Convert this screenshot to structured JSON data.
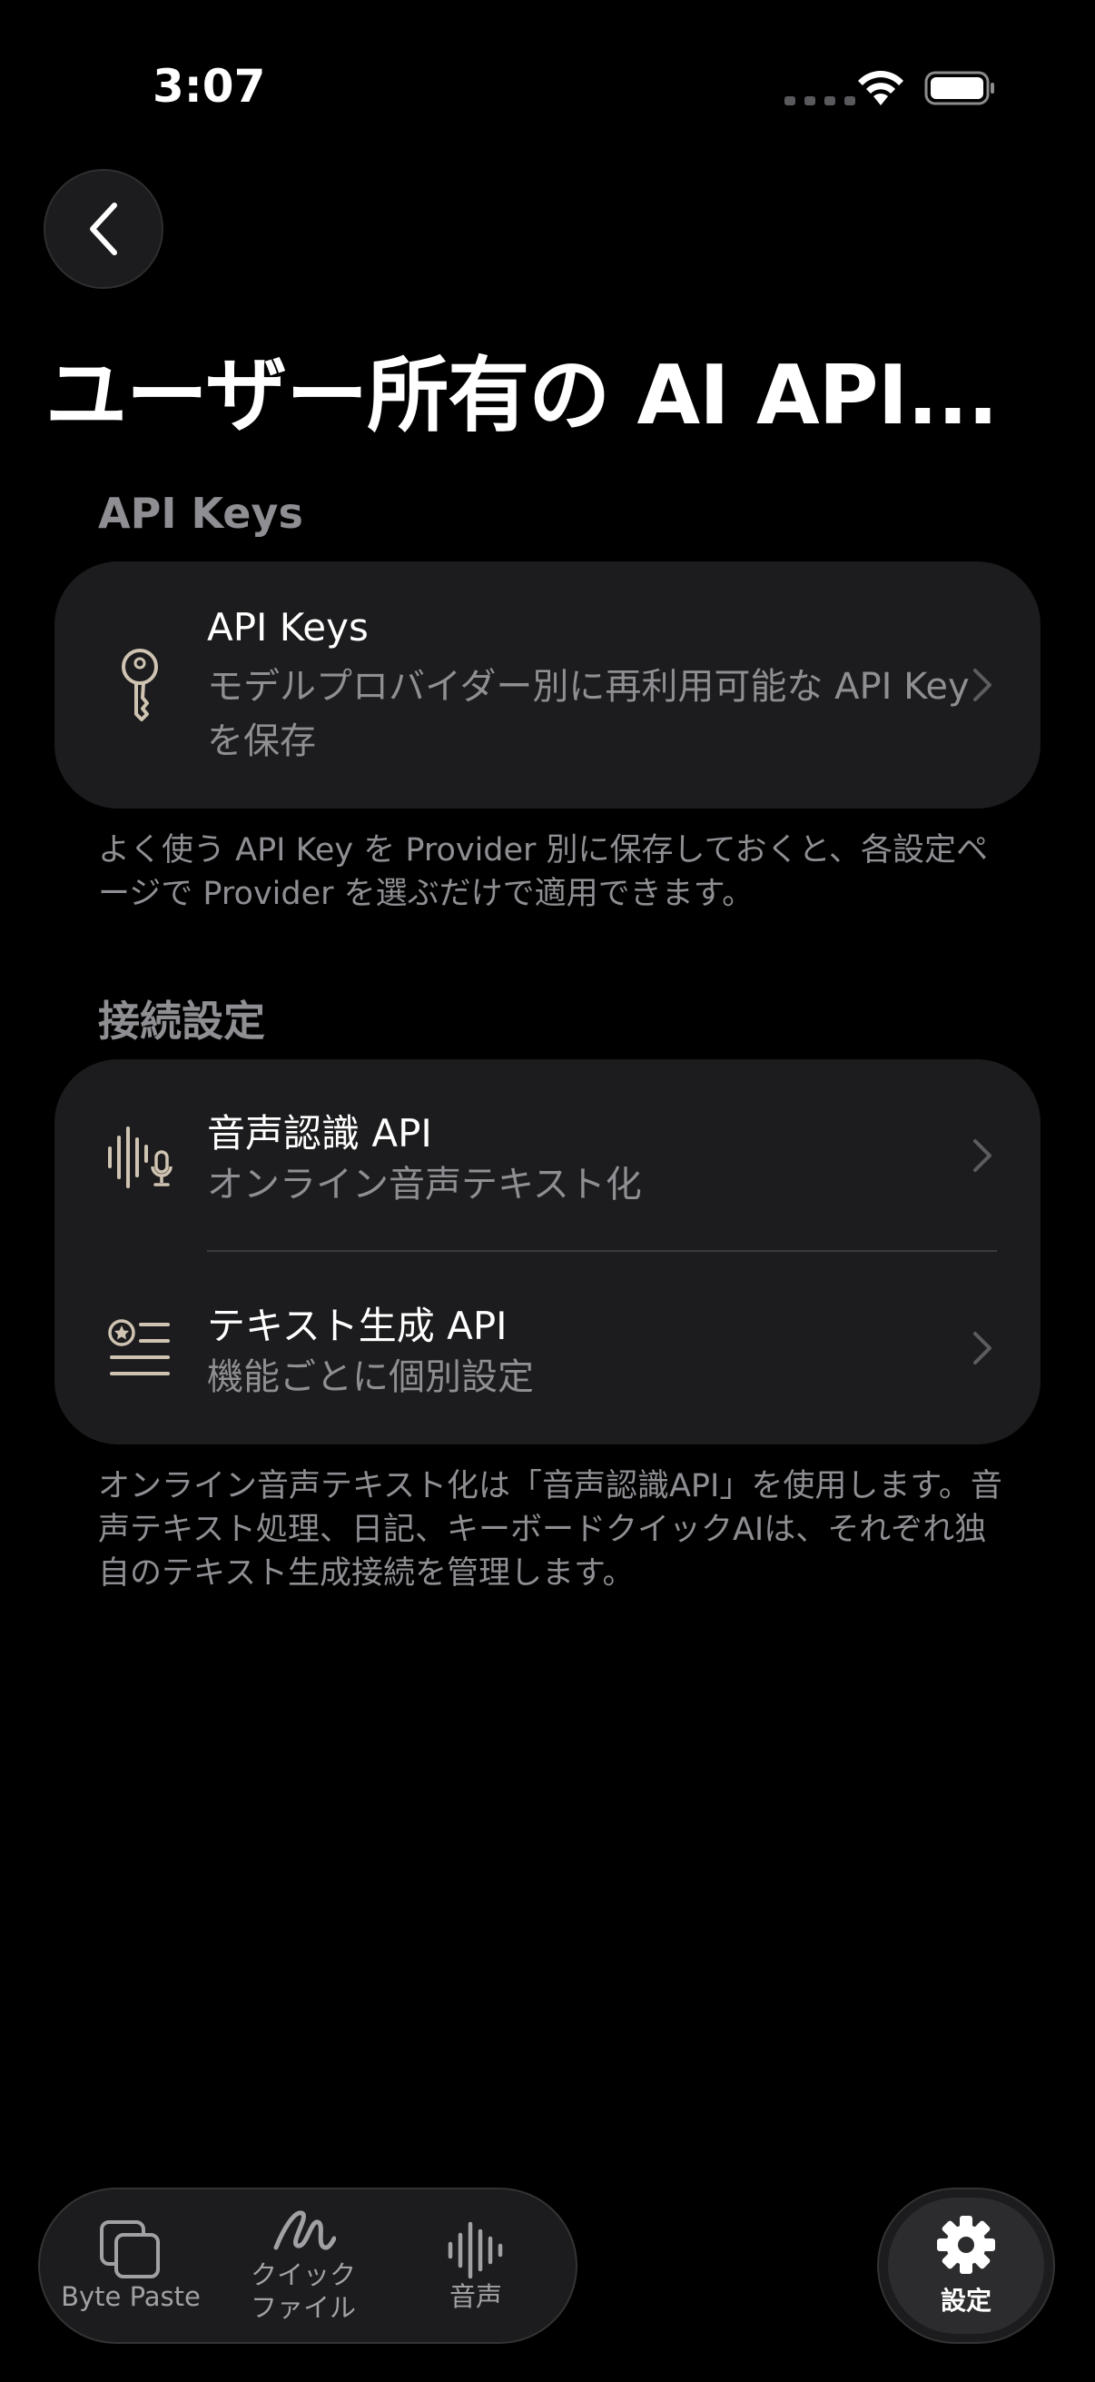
{
  "status_bar": {
    "time": "3:07"
  },
  "nav": {
    "title": "ユーザー所有の AI API..."
  },
  "sections": {
    "api_keys": {
      "header": "API Keys",
      "row": {
        "title": "API Keys",
        "subtitle": "モデルプロバイダー別に再利用可能な API Key を保存",
        "icon": "key-icon"
      },
      "footnote": "よく使う API Key を Provider 別に保存しておくと、各設定ページで Provider を選ぶだけで適用できます。"
    },
    "connection": {
      "header": "接続設定",
      "rows": [
        {
          "title": "音声認識 API",
          "subtitle": "オンライン音声テキスト化",
          "icon": "waveform-mic-icon"
        },
        {
          "title": "テキスト生成 API",
          "subtitle": "機能ごとに個別設定",
          "icon": "text-list-star-icon"
        }
      ],
      "footnote": "オンライン音声テキスト化は「音声認識API」を使用します。音声テキスト処理、日記、キーボードクイックAIは、それぞれ独自のテキスト生成接続を管理します。"
    }
  },
  "tabbar": {
    "tabs": [
      {
        "label": "Byte Paste",
        "icon": "copy-icon"
      },
      {
        "label": "クイック\nファイル",
        "icon": "scribble-icon"
      },
      {
        "label": "音声",
        "icon": "waveform-icon"
      }
    ],
    "settings": {
      "label": "設定",
      "icon": "gear-icon"
    }
  },
  "colors": {
    "background": "#000000",
    "card": "#1c1c1e",
    "secondary_text": "#8e8e93",
    "icon_tint": "#cfc4b2"
  }
}
